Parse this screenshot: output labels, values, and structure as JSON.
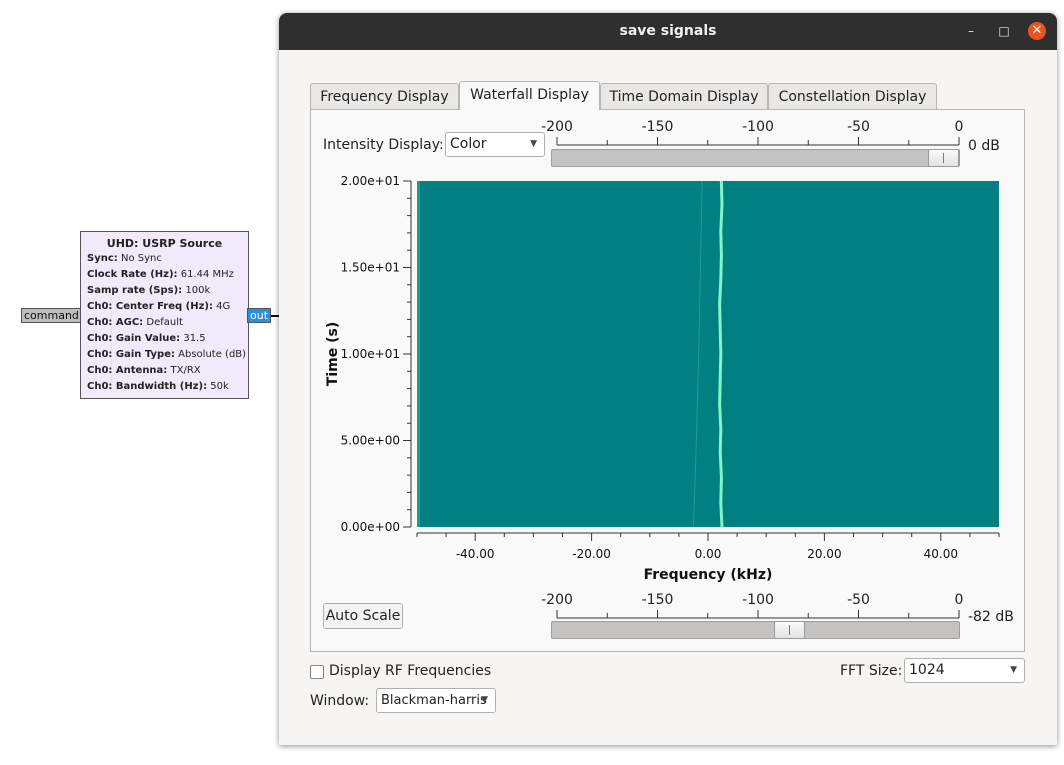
{
  "flowgraph": {
    "block": {
      "title": "UHD: USRP Source",
      "params": [
        {
          "key": "Sync:",
          "value": "No Sync"
        },
        {
          "key": "Clock Rate (Hz):",
          "value": "61.44 MHz"
        },
        {
          "key": "Samp rate (Sps):",
          "value": "100k"
        },
        {
          "key": "Ch0: Center Freq (Hz):",
          "value": "4G"
        },
        {
          "key": "Ch0: AGC:",
          "value": "Default"
        },
        {
          "key": "Ch0: Gain Value:",
          "value": "31.5"
        },
        {
          "key": "Ch0: Gain Type:",
          "value": "Absolute (dB)"
        },
        {
          "key": "Ch0: Antenna:",
          "value": "TX/RX"
        },
        {
          "key": "Ch0: Bandwidth (Hz):",
          "value": "50k"
        }
      ]
    },
    "in_port": "command",
    "out_port": "out"
  },
  "window": {
    "title": "save signals",
    "minimize_glyph": "–",
    "maximize_glyph": "□",
    "close_glyph": "✕"
  },
  "tabs": [
    {
      "label": "Frequency Display",
      "active": false
    },
    {
      "label": "Waterfall Display",
      "active": true
    },
    {
      "label": "Time Domain Display",
      "active": false
    },
    {
      "label": "Constellation Display",
      "active": false
    }
  ],
  "intensity": {
    "label": "Intensity Display:",
    "value": "Color",
    "scale_ticks": [
      "-200",
      "-150",
      "-100",
      "-50",
      "0"
    ],
    "max_db": "0 dB",
    "max_db_fraction": 1.0
  },
  "min_intensity": {
    "scale_ticks": [
      "-200",
      "-150",
      "-100",
      "-50",
      "0"
    ],
    "min_db": "-82 dB",
    "min_db_fraction": 0.59
  },
  "auto_scale_label": "Auto Scale",
  "display_rf": {
    "label": "Display RF Frequencies",
    "checked": false
  },
  "fft": {
    "label": "FFT Size:",
    "value": "1024"
  },
  "window_func": {
    "label": "Window:",
    "value": "Blackman-harris"
  },
  "colors": {
    "waterfall_background": "#008080",
    "signal_trace": "#7ff7c8",
    "window_titlebar": "#2f2f2f",
    "close_button": "#e95420",
    "out_port": "#2b8fe0",
    "block_fill": "#f0eafb"
  },
  "chart_data": {
    "type": "heatmap",
    "title": "",
    "xlabel": "Frequency (kHz)",
    "ylabel": "Time (s)",
    "xlim": [
      -50,
      50
    ],
    "ylim": [
      0,
      20
    ],
    "x_ticks": [
      "-40.00",
      "-20.00",
      "0.00",
      "20.00",
      "40.00"
    ],
    "x_tick_values": [
      -40,
      -20,
      0,
      20,
      40
    ],
    "y_ticks": [
      "0.00e+00",
      "5.00e+00",
      "1.00e+01",
      "1.50e+01",
      "2.00e+01"
    ],
    "y_tick_values": [
      0,
      5,
      10,
      15,
      20
    ],
    "signal_trace": {
      "x_khz": [
        2.4,
        2.2,
        2.3,
        2.1,
        2.2,
        2.0,
        2.1,
        2.2,
        2.1,
        2.0,
        2.2,
        2.3,
        2.2,
        2.4,
        2.3
      ],
      "t_s": [
        0,
        1.4,
        2.9,
        4.3,
        5.7,
        7.1,
        8.6,
        10.0,
        11.4,
        12.9,
        14.3,
        15.7,
        17.1,
        18.6,
        20.0
      ]
    },
    "faint_trace": {
      "x_khz": [
        -2.5,
        -2.0,
        -1.6,
        -1.3,
        -1.0
      ],
      "t_s": [
        0,
        5,
        10,
        15,
        20
      ]
    }
  }
}
